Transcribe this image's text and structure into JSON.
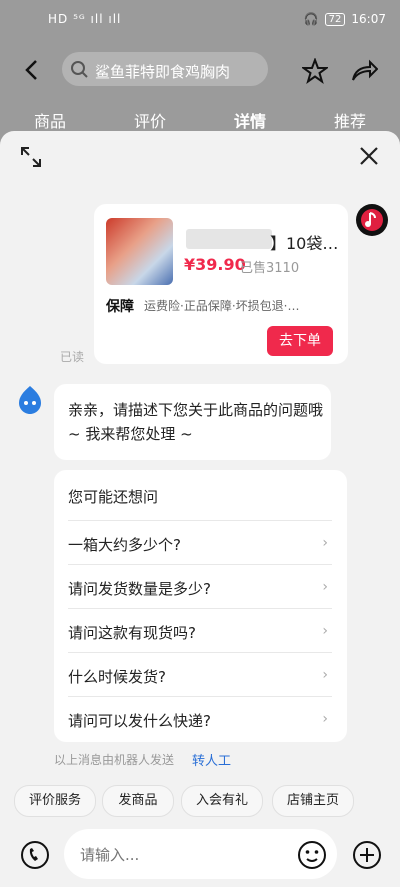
{
  "status": {
    "left": "HD ⁵ᴳ ıll ıll",
    "time": "16:07",
    "battery": "72"
  },
  "topbar": {
    "search_text": "鲨鱼菲特即食鸡胸肉"
  },
  "tabs": [
    {
      "label": "商品"
    },
    {
      "label": "评价"
    },
    {
      "label": "详情"
    },
    {
      "label": "推荐"
    }
  ],
  "product": {
    "title_suffix": "】10袋…",
    "price": "¥39.90",
    "sold": "已售3110",
    "guarantee_label": "保障",
    "guarantee_text": "运费险·正品保障·坏损包退·…",
    "order_button": "去下单"
  },
  "read_status": "已读",
  "bot_message": "亲亲，请描述下您关于此商品的问题哦 ~ 我来帮您处理 ~",
  "faq": {
    "title": "您可能还想问",
    "items": [
      {
        "label": "一箱大约多少个?"
      },
      {
        "label": "请问发货数量是多少?"
      },
      {
        "label": "请问这款有现货吗?"
      },
      {
        "label": "什么时候发货?"
      },
      {
        "label": "请问可以发什么快递?"
      }
    ]
  },
  "robot_note": "以上消息由机器人发送",
  "transfer_label": "转人工",
  "quick_actions": [
    {
      "label": "评价服务"
    },
    {
      "label": "发商品"
    },
    {
      "label": "入会有礼"
    },
    {
      "label": "店铺主页"
    }
  ],
  "input": {
    "placeholder": "请输入..."
  },
  "colors": {
    "accent_red": "#f0294c",
    "link_blue": "#2a6fd6"
  }
}
